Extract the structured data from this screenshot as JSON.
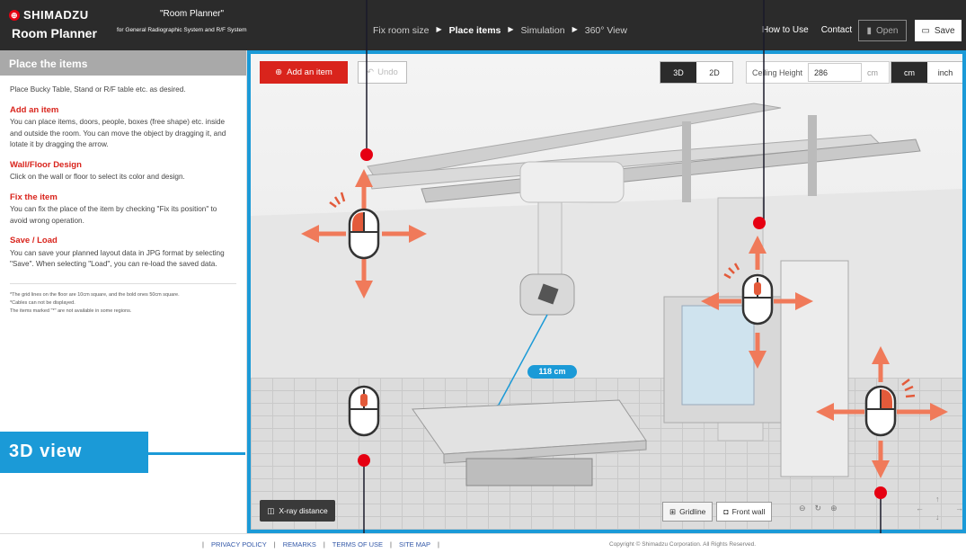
{
  "header": {
    "brand": "SHIMADZU",
    "app_title": "Room Planner",
    "product_title": "\"Room Planner\"",
    "product_subtitle": "for General Radiographic System and R/F System",
    "steps": [
      "Fix room size",
      "Place items",
      "Simulation",
      "360° View"
    ],
    "active_step": "Place items",
    "links": [
      "How to Use",
      "Contact"
    ],
    "open_label": "Open",
    "save_label": "Save"
  },
  "sidebar": {
    "title": "Place the items",
    "intro": "Place Bucky Table, Stand or R/F table etc. as desired.",
    "sections": [
      {
        "heading": "Add an item",
        "text": "You can place items, doors, people, boxes (free shape) etc. inside and outside the room. You can move the object by dragging it, and lotate it by dragging the arrow."
      },
      {
        "heading": "Wall/Floor Design",
        "text": "Click on the wall or floor to select its color and design."
      },
      {
        "heading": "Fix the item",
        "text": "You can fix the place of the item by checking \"Fix its position\" to avoid wrong operation."
      },
      {
        "heading": "Save / Load",
        "text": "You can save your planned layout data in JPG format by selecting \"Save\". When selecting \"Load\", you can re-load the saved data."
      }
    ],
    "notes": [
      "*The grid lines on the floor are 10cm square, and the bold ones 50cm square.",
      "*Cables can not be displayed.",
      "The items marked \"*\" are not available in some regions."
    ]
  },
  "callout": {
    "label": "3D view",
    "color": "#1b9ad7"
  },
  "viewer": {
    "add_item_label": "Add an item",
    "undo_label": "Undo",
    "view_modes": [
      "3D",
      "2D"
    ],
    "active_view": "3D",
    "ceiling_label": "Ceiling Height",
    "ceiling_value": "286",
    "ceiling_unit": "cm",
    "units": [
      "cm",
      "inch"
    ],
    "active_unit": "cm",
    "xray_distance_label": "X-ray distance",
    "distance_badge": "118 cm",
    "gridline_label": "Gridline",
    "front_wall_label": "Front wall",
    "zoom_symbols": [
      "⊖",
      "↻",
      "⊕"
    ],
    "pan_symbols": [
      "←",
      "↑",
      "↓",
      "→"
    ]
  },
  "footer": {
    "links": [
      "PRIVACY POLICY",
      "REMARKS",
      "TERMS OF USE",
      "SITE MAP"
    ],
    "copyright": "Copyright © Shimadzu Corporation. All Rights Reserved."
  },
  "colors": {
    "accent_red": "#d9241c",
    "accent_blue": "#1b9ad7",
    "arrow_orange": "#f07a5a",
    "header_bg": "#2b2b2b"
  }
}
